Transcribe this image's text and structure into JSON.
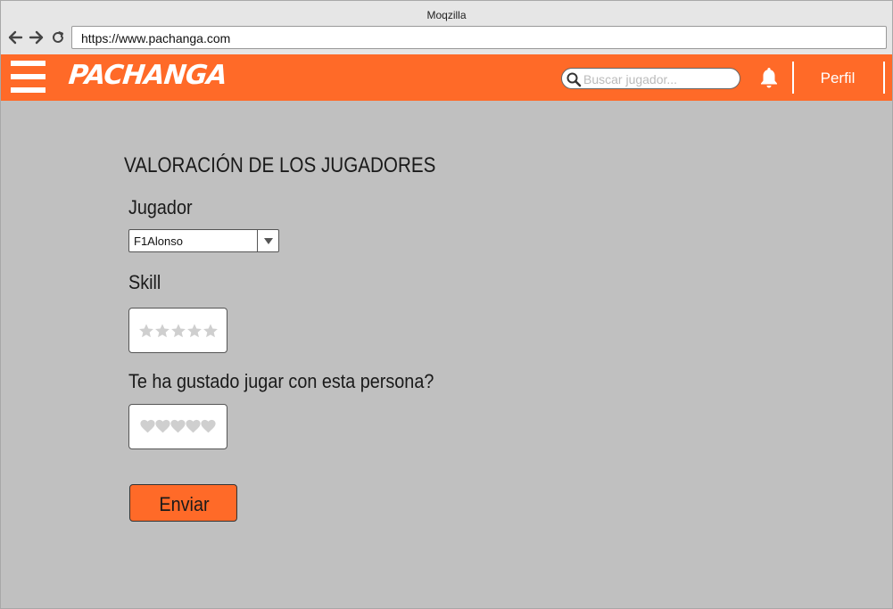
{
  "browser": {
    "window_title": "Moqzilla",
    "url": "https://www.pachanga.com"
  },
  "appbar": {
    "logo": "PACHANGA",
    "search_placeholder": "Buscar jugador...",
    "profile_label": "Perfil",
    "accent_color": "#ff6a28"
  },
  "form": {
    "title": "VALORACIÓN DE LOS JUGADORES",
    "player_label": "Jugador",
    "player_selected": "F1Alonso",
    "skill_label": "Skill",
    "skill_rating": 0,
    "skill_max": 5,
    "liked_label": "Te ha gustado jugar con esta persona?",
    "liked_rating": 0,
    "liked_max": 5,
    "submit_label": "Enviar"
  },
  "icons": {
    "menu": "hamburger-icon",
    "search": "search-icon",
    "notifications": "bell-icon",
    "dropdown": "chevron-down-icon",
    "skill_rating": "star-icon",
    "liked_rating": "heart-icon",
    "back": "arrow-left-icon",
    "forward": "arrow-right-icon",
    "reload": "reload-icon"
  }
}
